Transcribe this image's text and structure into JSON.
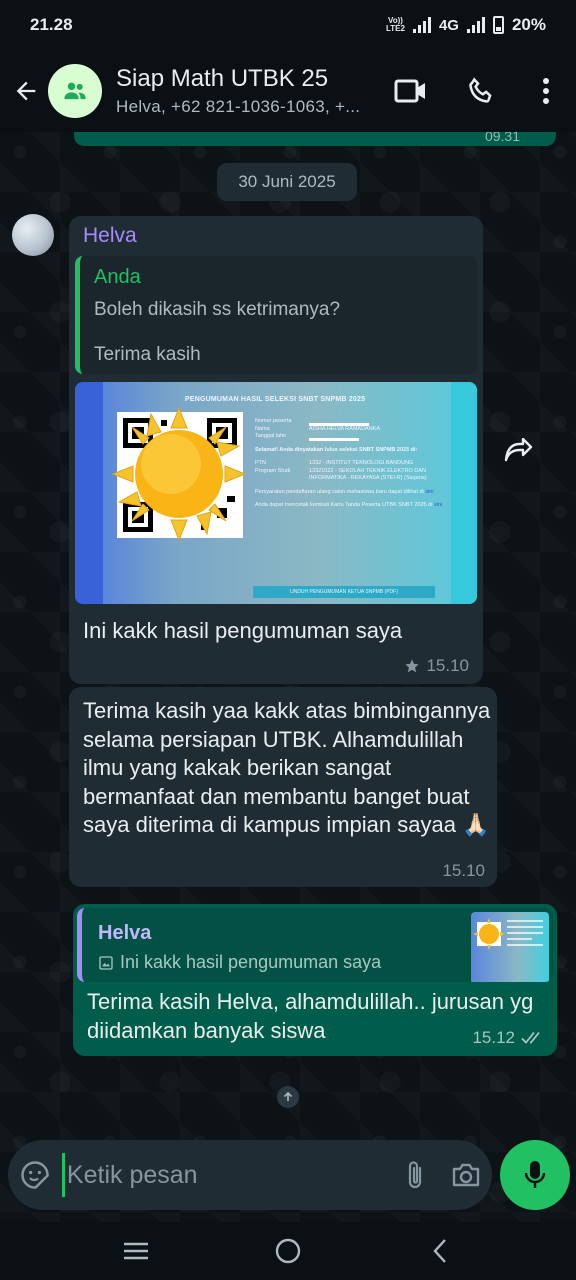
{
  "status_bar": {
    "time": "21.28",
    "volte_top": "Vo))",
    "volte_bottom": "LTE2",
    "network": "4G",
    "battery": "20%"
  },
  "header": {
    "group_name": "Siap Math UTBK 25",
    "members": "Helva, +62 821-1036-1063, +..."
  },
  "chat": {
    "previous_time": "09.31",
    "date_label": "30 Juni 2025",
    "messages": [
      {
        "sender": "Helva",
        "quote_author": "Anda",
        "quote_line1": "Boleh dikasih ss ketrimanya?",
        "quote_line2": "Terima kasih",
        "image": {
          "title": "PENGUMUMAN HASIL SELEKSI SNBT SNPMB 2025",
          "label_nomor": "Nomor peserta",
          "label_nama": "Nama",
          "value_nama": "AISHA HELVA RAMADANKA",
          "label_tgl": "Tanggal lahir",
          "selamat": "Selamat! Anda dinyatakan lulus seleksi SNBT SNPMB 2025 di:",
          "label_ptn": "PTN",
          "value_ptn": "1332 - INSTITUT TEKNOLOGI BANDUNG",
          "label_prodi": "Program Studi",
          "value_prodi": "13321022 - SEKOLAH TEKNIK ELEKTRO DAN INFORMATIKA - REKAYASA (STEI-R) (Sarjana)",
          "note1": "Persyaratan pendaftaran ulang calon mahasiswa baru dapat dilihat di",
          "note1_link": "sini",
          "note2": "Anda dapat mencetak kembali Kartu Tanda Peserta UTBK SNBT 2025 di",
          "note2_link": "sini",
          "button": "UNDUH PENGUMUMAN KETUA SNPMB (PDF)"
        },
        "caption": "Ini kakk hasil pengumuman saya",
        "time": "15.10"
      },
      {
        "text": "Terima kasih yaa kakk atas bimbingannya selama persiapan UTBK. Alhamdulillah ilmu yang kakak berikan sangat bermanfaat dan membantu banget buat saya diterima di kampus impian sayaa 🙏🏻",
        "time": "15.10"
      },
      {
        "quote_author": "Helva",
        "quote_text": "Ini kakk hasil pengumuman saya",
        "text": "Terima kasih Helva, alhamdulillah.. jurusan yg diidamkan banyak siswa",
        "time": "15.12"
      }
    ]
  },
  "composer": {
    "placeholder": "Ketik pesan"
  },
  "colors": {
    "accent_green": "#21c063",
    "outgoing_bubble": "#005c4b",
    "incoming_bubble": "#1f2c34",
    "sender_purple": "#a78bfa"
  },
  "icons": [
    "back-arrow-icon",
    "group-icon",
    "video-call-icon",
    "phone-icon",
    "more-options-icon",
    "forward-icon",
    "star-icon",
    "image-icon",
    "double-check-icon",
    "arrow-up-icon",
    "sticker-icon",
    "attach-icon",
    "camera-icon",
    "mic-icon",
    "recents-icon",
    "home-icon",
    "back-icon"
  ]
}
